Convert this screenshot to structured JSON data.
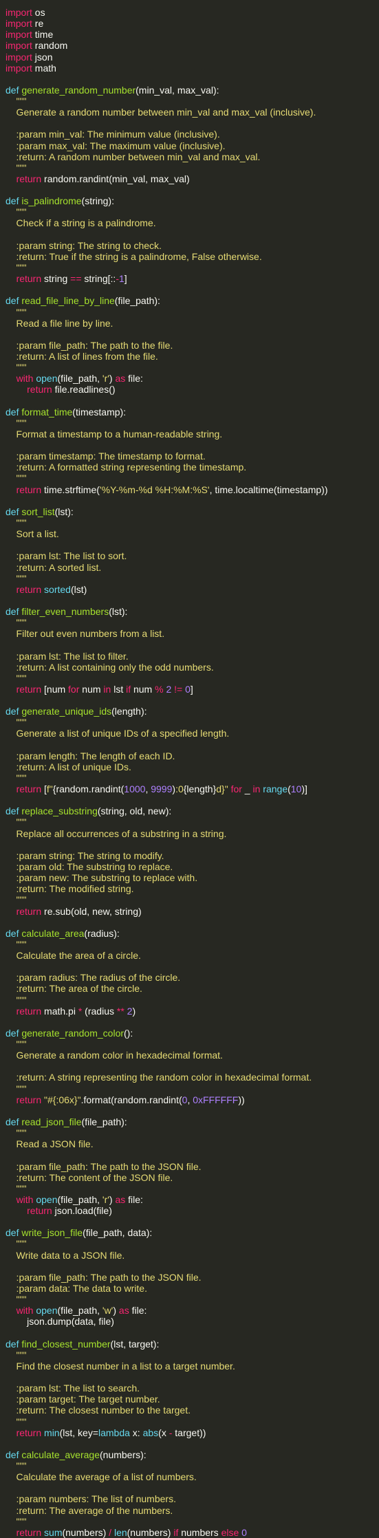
{
  "colors": {
    "background": "#272822",
    "default": "#f8f8f2",
    "keyword": "#f92672",
    "function_name": "#a6e22e",
    "builtin": "#66d9ef",
    "string": "#e6db74",
    "number": "#ae81ff"
  },
  "icon_names": [],
  "code": {
    "lines": [
      [
        [
          "kw",
          "import"
        ],
        [
          "tx",
          " os"
        ]
      ],
      [
        [
          "kw",
          "import"
        ],
        [
          "tx",
          " re"
        ]
      ],
      [
        [
          "kw",
          "import"
        ],
        [
          "tx",
          " time"
        ]
      ],
      [
        [
          "kw",
          "import"
        ],
        [
          "tx",
          " random"
        ]
      ],
      [
        [
          "kw",
          "import"
        ],
        [
          "tx",
          " json"
        ]
      ],
      [
        [
          "kw",
          "import"
        ],
        [
          "tx",
          " math"
        ]
      ],
      [],
      [
        [
          "bi",
          "def "
        ],
        [
          "fn",
          "generate_random_number"
        ],
        [
          "tx",
          "(min_val, max_val):"
        ]
      ],
      [
        [
          "st",
          "    \"\"\""
        ]
      ],
      [
        [
          "st",
          "    Generate a random number between min_val and max_val (inclusive)."
        ]
      ],
      [],
      [
        [
          "st",
          "    :param min_val: The minimum value (inclusive)."
        ]
      ],
      [
        [
          "st",
          "    :param max_val: The maximum value (inclusive)."
        ]
      ],
      [
        [
          "st",
          "    :return: A random number between min_val and max_val."
        ]
      ],
      [
        [
          "st",
          "    \"\"\""
        ]
      ],
      [
        [
          "tx",
          "    "
        ],
        [
          "kw",
          "return"
        ],
        [
          "tx",
          " random.randint(min_val, max_val)"
        ]
      ],
      [],
      [
        [
          "bi",
          "def "
        ],
        [
          "fn",
          "is_palindrome"
        ],
        [
          "tx",
          "(string):"
        ]
      ],
      [
        [
          "st",
          "    \"\"\""
        ]
      ],
      [
        [
          "st",
          "    Check if a string is a palindrome."
        ]
      ],
      [],
      [
        [
          "st",
          "    :param string: The string to check."
        ]
      ],
      [
        [
          "st",
          "    :return: True if the string is a palindrome, False otherwise."
        ]
      ],
      [
        [
          "st",
          "    \"\"\""
        ]
      ],
      [
        [
          "tx",
          "    "
        ],
        [
          "kw",
          "return"
        ],
        [
          "tx",
          " string "
        ],
        [
          "kw",
          "=="
        ],
        [
          "tx",
          " string[::"
        ],
        [
          "kw",
          "-"
        ],
        [
          "nm",
          "1"
        ],
        [
          "tx",
          "]"
        ]
      ],
      [],
      [
        [
          "bi",
          "def "
        ],
        [
          "fn",
          "read_file_line_by_line"
        ],
        [
          "tx",
          "(file_path):"
        ]
      ],
      [
        [
          "st",
          "    \"\"\""
        ]
      ],
      [
        [
          "st",
          "    Read a file line by line."
        ]
      ],
      [],
      [
        [
          "st",
          "    :param file_path: The path to the file."
        ]
      ],
      [
        [
          "st",
          "    :return: A list of lines from the file."
        ]
      ],
      [
        [
          "st",
          "    \"\"\""
        ]
      ],
      [
        [
          "tx",
          "    "
        ],
        [
          "kw",
          "with"
        ],
        [
          "tx",
          " "
        ],
        [
          "bi",
          "open"
        ],
        [
          "tx",
          "(file_path, "
        ],
        [
          "st",
          "'r'"
        ],
        [
          "tx",
          ") "
        ],
        [
          "kw",
          "as"
        ],
        [
          "tx",
          " file:"
        ]
      ],
      [
        [
          "tx",
          "        "
        ],
        [
          "kw",
          "return"
        ],
        [
          "tx",
          " file.readlines()"
        ]
      ],
      [],
      [
        [
          "bi",
          "def "
        ],
        [
          "fn",
          "format_time"
        ],
        [
          "tx",
          "(timestamp):"
        ]
      ],
      [
        [
          "st",
          "    \"\"\""
        ]
      ],
      [
        [
          "st",
          "    Format a timestamp to a human-readable string."
        ]
      ],
      [],
      [
        [
          "st",
          "    :param timestamp: The timestamp to format."
        ]
      ],
      [
        [
          "st",
          "    :return: A formatted string representing the timestamp."
        ]
      ],
      [
        [
          "st",
          "    \"\"\""
        ]
      ],
      [
        [
          "tx",
          "    "
        ],
        [
          "kw",
          "return"
        ],
        [
          "tx",
          " time.strftime("
        ],
        [
          "st",
          "'%Y-%m-%d %H:%M:%S'"
        ],
        [
          "tx",
          ", time.localtime(timestamp))"
        ]
      ],
      [],
      [
        [
          "bi",
          "def "
        ],
        [
          "fn",
          "sort_list"
        ],
        [
          "tx",
          "(lst):"
        ]
      ],
      [
        [
          "st",
          "    \"\"\""
        ]
      ],
      [
        [
          "st",
          "    Sort a list."
        ]
      ],
      [],
      [
        [
          "st",
          "    :param lst: The list to sort."
        ]
      ],
      [
        [
          "st",
          "    :return: A sorted list."
        ]
      ],
      [
        [
          "st",
          "    \"\"\""
        ]
      ],
      [
        [
          "tx",
          "    "
        ],
        [
          "kw",
          "return"
        ],
        [
          "tx",
          " "
        ],
        [
          "bi",
          "sorted"
        ],
        [
          "tx",
          "(lst)"
        ]
      ],
      [],
      [
        [
          "bi",
          "def "
        ],
        [
          "fn",
          "filter_even_numbers"
        ],
        [
          "tx",
          "(lst):"
        ]
      ],
      [
        [
          "st",
          "    \"\"\""
        ]
      ],
      [
        [
          "st",
          "    Filter out even numbers from a list."
        ]
      ],
      [],
      [
        [
          "st",
          "    :param lst: The list to filter."
        ]
      ],
      [
        [
          "st",
          "    :return: A list containing only the odd numbers."
        ]
      ],
      [
        [
          "st",
          "    \"\"\""
        ]
      ],
      [
        [
          "tx",
          "    "
        ],
        [
          "kw",
          "return"
        ],
        [
          "tx",
          " [num "
        ],
        [
          "kw",
          "for"
        ],
        [
          "tx",
          " num "
        ],
        [
          "kw",
          "in"
        ],
        [
          "tx",
          " lst "
        ],
        [
          "kw",
          "if"
        ],
        [
          "tx",
          " num "
        ],
        [
          "kw",
          "%"
        ],
        [
          "tx",
          " "
        ],
        [
          "nm",
          "2"
        ],
        [
          "tx",
          " "
        ],
        [
          "kw",
          "!="
        ],
        [
          "tx",
          " "
        ],
        [
          "nm",
          "0"
        ],
        [
          "tx",
          "]"
        ]
      ],
      [],
      [
        [
          "bi",
          "def "
        ],
        [
          "fn",
          "generate_unique_ids"
        ],
        [
          "tx",
          "(length):"
        ]
      ],
      [
        [
          "st",
          "    \"\"\""
        ]
      ],
      [
        [
          "st",
          "    Generate a list of unique IDs of a specified length."
        ]
      ],
      [],
      [
        [
          "st",
          "    :param length: The length of each ID."
        ]
      ],
      [
        [
          "st",
          "    :return: A list of unique IDs."
        ]
      ],
      [
        [
          "st",
          "    \"\"\""
        ]
      ],
      [
        [
          "tx",
          "    "
        ],
        [
          "kw",
          "return"
        ],
        [
          "tx",
          " ["
        ],
        [
          "st",
          "f\""
        ],
        [
          "tx",
          "{random.randint("
        ],
        [
          "nm",
          "1000"
        ],
        [
          "tx",
          ", "
        ],
        [
          "nm",
          "9999"
        ],
        [
          "tx",
          ")"
        ],
        [
          "st",
          ":0"
        ],
        [
          "tx",
          "{length}"
        ],
        [
          "st",
          "d}\""
        ],
        [
          "tx",
          " "
        ],
        [
          "kw",
          "for"
        ],
        [
          "tx",
          " _ "
        ],
        [
          "kw",
          "in"
        ],
        [
          "tx",
          " "
        ],
        [
          "bi",
          "range"
        ],
        [
          "tx",
          "("
        ],
        [
          "nm",
          "10"
        ],
        [
          "tx",
          ")]"
        ]
      ],
      [],
      [
        [
          "bi",
          "def "
        ],
        [
          "fn",
          "replace_substring"
        ],
        [
          "tx",
          "(string, old, new):"
        ]
      ],
      [
        [
          "st",
          "    \"\"\""
        ]
      ],
      [
        [
          "st",
          "    Replace all occurrences of a substring in a string."
        ]
      ],
      [],
      [
        [
          "st",
          "    :param string: The string to modify."
        ]
      ],
      [
        [
          "st",
          "    :param old: The substring to replace."
        ]
      ],
      [
        [
          "st",
          "    :param new: The substring to replace with."
        ]
      ],
      [
        [
          "st",
          "    :return: The modified string."
        ]
      ],
      [
        [
          "st",
          "    \"\"\""
        ]
      ],
      [
        [
          "tx",
          "    "
        ],
        [
          "kw",
          "return"
        ],
        [
          "tx",
          " re.sub(old, new, string)"
        ]
      ],
      [],
      [
        [
          "bi",
          "def "
        ],
        [
          "fn",
          "calculate_area"
        ],
        [
          "tx",
          "(radius):"
        ]
      ],
      [
        [
          "st",
          "    \"\"\""
        ]
      ],
      [
        [
          "st",
          "    Calculate the area of a circle."
        ]
      ],
      [],
      [
        [
          "st",
          "    :param radius: The radius of the circle."
        ]
      ],
      [
        [
          "st",
          "    :return: The area of the circle."
        ]
      ],
      [
        [
          "st",
          "    \"\"\""
        ]
      ],
      [
        [
          "tx",
          "    "
        ],
        [
          "kw",
          "return"
        ],
        [
          "tx",
          " math.pi "
        ],
        [
          "kw",
          "*"
        ],
        [
          "tx",
          " (radius "
        ],
        [
          "kw",
          "**"
        ],
        [
          "tx",
          " "
        ],
        [
          "nm",
          "2"
        ],
        [
          "tx",
          ")"
        ]
      ],
      [],
      [
        [
          "bi",
          "def "
        ],
        [
          "fn",
          "generate_random_color"
        ],
        [
          "tx",
          "():"
        ]
      ],
      [
        [
          "st",
          "    \"\"\""
        ]
      ],
      [
        [
          "st",
          "    Generate a random color in hexadecimal format."
        ]
      ],
      [],
      [
        [
          "st",
          "    :return: A string representing the random color in hexadecimal format."
        ]
      ],
      [
        [
          "st",
          "    \"\"\""
        ]
      ],
      [
        [
          "tx",
          "    "
        ],
        [
          "kw",
          "return"
        ],
        [
          "tx",
          " "
        ],
        [
          "st",
          "\"#{:06x}\""
        ],
        [
          "tx",
          ".format(random.randint("
        ],
        [
          "nm",
          "0"
        ],
        [
          "tx",
          ", "
        ],
        [
          "nm",
          "0xFFFFFF"
        ],
        [
          "tx",
          "))"
        ]
      ],
      [],
      [
        [
          "bi",
          "def "
        ],
        [
          "fn",
          "read_json_file"
        ],
        [
          "tx",
          "(file_path):"
        ]
      ],
      [
        [
          "st",
          "    \"\"\""
        ]
      ],
      [
        [
          "st",
          "    Read a JSON file."
        ]
      ],
      [],
      [
        [
          "st",
          "    :param file_path: The path to the JSON file."
        ]
      ],
      [
        [
          "st",
          "    :return: The content of the JSON file."
        ]
      ],
      [
        [
          "st",
          "    \"\"\""
        ]
      ],
      [
        [
          "tx",
          "    "
        ],
        [
          "kw",
          "with"
        ],
        [
          "tx",
          " "
        ],
        [
          "bi",
          "open"
        ],
        [
          "tx",
          "(file_path, "
        ],
        [
          "st",
          "'r'"
        ],
        [
          "tx",
          ") "
        ],
        [
          "kw",
          "as"
        ],
        [
          "tx",
          " file:"
        ]
      ],
      [
        [
          "tx",
          "        "
        ],
        [
          "kw",
          "return"
        ],
        [
          "tx",
          " json.load(file)"
        ]
      ],
      [],
      [
        [
          "bi",
          "def "
        ],
        [
          "fn",
          "write_json_file"
        ],
        [
          "tx",
          "(file_path, data):"
        ]
      ],
      [
        [
          "st",
          "    \"\"\""
        ]
      ],
      [
        [
          "st",
          "    Write data to a JSON file."
        ]
      ],
      [],
      [
        [
          "st",
          "    :param file_path: The path to the JSON file."
        ]
      ],
      [
        [
          "st",
          "    :param data: The data to write."
        ]
      ],
      [
        [
          "st",
          "    \"\"\""
        ]
      ],
      [
        [
          "tx",
          "    "
        ],
        [
          "kw",
          "with"
        ],
        [
          "tx",
          " "
        ],
        [
          "bi",
          "open"
        ],
        [
          "tx",
          "(file_path, "
        ],
        [
          "st",
          "'w'"
        ],
        [
          "tx",
          ") "
        ],
        [
          "kw",
          "as"
        ],
        [
          "tx",
          " file:"
        ]
      ],
      [
        [
          "tx",
          "        json.dump(data, file)"
        ]
      ],
      [],
      [
        [
          "bi",
          "def "
        ],
        [
          "fn",
          "find_closest_number"
        ],
        [
          "tx",
          "(lst, target):"
        ]
      ],
      [
        [
          "st",
          "    \"\"\""
        ]
      ],
      [
        [
          "st",
          "    Find the closest number in a list to a target number."
        ]
      ],
      [],
      [
        [
          "st",
          "    :param lst: The list to search."
        ]
      ],
      [
        [
          "st",
          "    :param target: The target number."
        ]
      ],
      [
        [
          "st",
          "    :return: The closest number to the target."
        ]
      ],
      [
        [
          "st",
          "    \"\"\""
        ]
      ],
      [
        [
          "tx",
          "    "
        ],
        [
          "kw",
          "return"
        ],
        [
          "tx",
          " "
        ],
        [
          "bi",
          "min"
        ],
        [
          "tx",
          "(lst, key="
        ],
        [
          "bi",
          "lambda"
        ],
        [
          "tx",
          " x: "
        ],
        [
          "bi",
          "abs"
        ],
        [
          "tx",
          "(x "
        ],
        [
          "kw",
          "-"
        ],
        [
          "tx",
          " target))"
        ]
      ],
      [],
      [
        [
          "bi",
          "def "
        ],
        [
          "fn",
          "calculate_average"
        ],
        [
          "tx",
          "(numbers):"
        ]
      ],
      [
        [
          "st",
          "    \"\"\""
        ]
      ],
      [
        [
          "st",
          "    Calculate the average of a list of numbers."
        ]
      ],
      [],
      [
        [
          "st",
          "    :param numbers: The list of numbers."
        ]
      ],
      [
        [
          "st",
          "    :return: The average of the numbers."
        ]
      ],
      [
        [
          "st",
          "    \"\"\""
        ]
      ],
      [
        [
          "tx",
          "    "
        ],
        [
          "kw",
          "return"
        ],
        [
          "tx",
          " "
        ],
        [
          "bi",
          "sum"
        ],
        [
          "tx",
          "(numbers) "
        ],
        [
          "kw",
          "/"
        ],
        [
          "tx",
          " "
        ],
        [
          "bi",
          "len"
        ],
        [
          "tx",
          "(numbers) "
        ],
        [
          "kw",
          "if"
        ],
        [
          "tx",
          " numbers "
        ],
        [
          "kw",
          "else"
        ],
        [
          "tx",
          " "
        ],
        [
          "nm",
          "0"
        ]
      ]
    ]
  }
}
